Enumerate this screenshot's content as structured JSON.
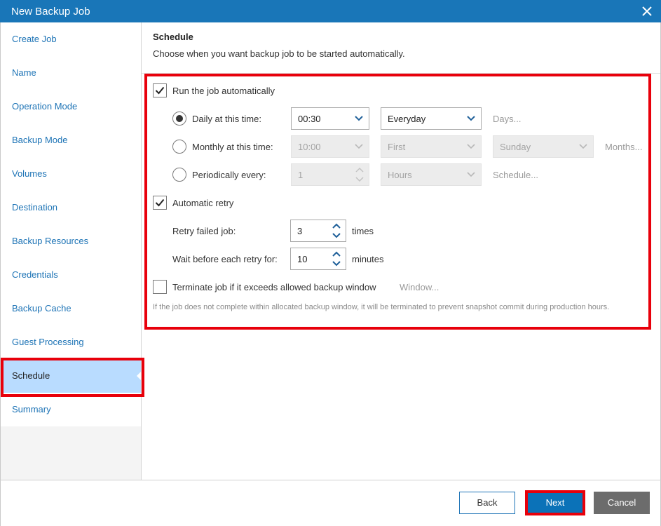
{
  "window": {
    "title": "New Backup Job"
  },
  "sidebar": {
    "items": [
      {
        "label": "Create Job"
      },
      {
        "label": "Name"
      },
      {
        "label": "Operation Mode"
      },
      {
        "label": "Backup Mode"
      },
      {
        "label": "Volumes"
      },
      {
        "label": "Destination"
      },
      {
        "label": "Backup Resources"
      },
      {
        "label": "Credentials"
      },
      {
        "label": "Backup Cache"
      },
      {
        "label": "Guest Processing"
      },
      {
        "label": "Schedule",
        "active": true
      },
      {
        "label": "Summary"
      }
    ]
  },
  "page": {
    "heading": "Schedule",
    "subheading": "Choose when you want backup job to be started automatically."
  },
  "schedule": {
    "run_automatically": {
      "label": "Run the job automatically",
      "checked": true
    },
    "daily": {
      "label": "Daily at this time:",
      "time": "00:30",
      "frequency": "Everyday",
      "link": "Days...",
      "selected": true
    },
    "monthly": {
      "label": "Monthly at this time:",
      "time": "10:00",
      "week": "First",
      "day": "Sunday",
      "link": "Months...",
      "selected": false
    },
    "periodically": {
      "label": "Periodically every:",
      "value": "1",
      "unit": "Hours",
      "link": "Schedule...",
      "selected": false
    },
    "retry": {
      "label": "Automatic retry",
      "checked": true,
      "failed_label": "Retry failed job:",
      "failed_value": "3",
      "failed_unit": "times",
      "wait_label": "Wait before each retry for:",
      "wait_value": "10",
      "wait_unit": "minutes"
    },
    "terminate": {
      "label": "Terminate job if it exceeds allowed backup window",
      "checked": false,
      "link": "Window...",
      "hint": "If the job does not complete within allocated backup window, it will be terminated to prevent snapshot commit during production hours."
    }
  },
  "footer": {
    "back_label": "Back",
    "next_label": "Next",
    "cancel_label": "Cancel"
  },
  "colors": {
    "titlebar": "#1976b8",
    "highlight": "#e8000b",
    "active_nav": "#b9dcff",
    "link": "#1e74b6"
  }
}
